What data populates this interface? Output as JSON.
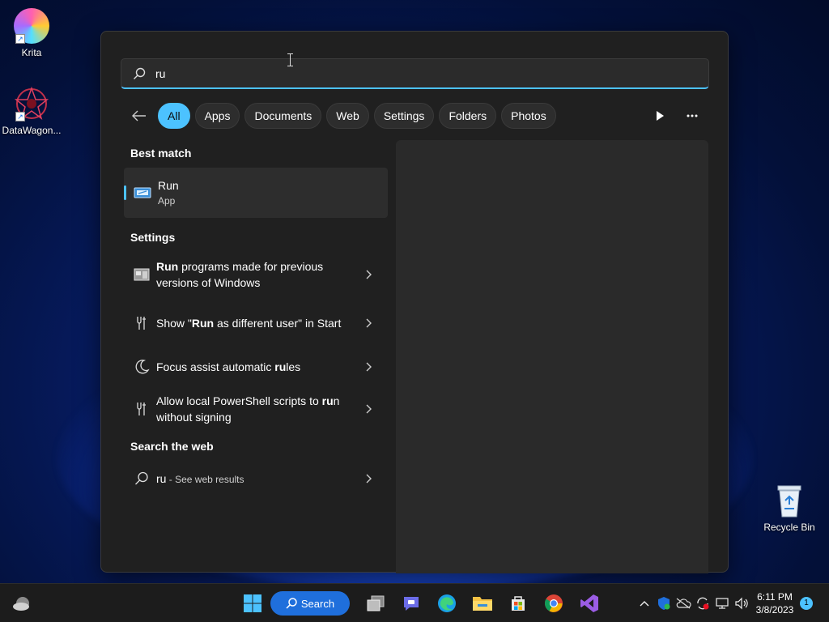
{
  "desktop": {
    "icons": [
      {
        "label": "Krita"
      },
      {
        "label": "DataWagon..."
      },
      {
        "label": "Recycle Bin"
      }
    ]
  },
  "search": {
    "query": "ru",
    "filters": [
      "All",
      "Apps",
      "Documents",
      "Web",
      "Settings",
      "Folders",
      "Photos"
    ],
    "active_filter": "All"
  },
  "results": {
    "best_match_title": "Best match",
    "best_match": {
      "name": "Run",
      "kind": "App"
    },
    "settings_title": "Settings",
    "settings": [
      {
        "pre": "",
        "bold": "Run",
        "post": " programs made for previous versions of Windows",
        "icon": "compatibility-icon"
      },
      {
        "pre": "Show \"",
        "bold": "Run",
        "post": " as different user\" in Start",
        "icon": "settings-tools-icon"
      },
      {
        "pre": "Focus assist automatic ",
        "bold": "ru",
        "post": "les",
        "icon": "moon-icon"
      },
      {
        "pre": "Allow local PowerShell scripts to ",
        "bold": "ru",
        "post": "n without signing",
        "icon": "settings-tools-icon"
      }
    ],
    "web_title": "Search the web",
    "web": {
      "query": "ru",
      "suffix": " - See web results"
    }
  },
  "taskbar": {
    "search_label": "Search",
    "time": "6:11 PM",
    "date": "3/8/2023",
    "notification_count": "1"
  },
  "colors": {
    "accent": "#4cc2ff",
    "panel_bg": "#202020",
    "taskbar_bg": "#1c1c1c",
    "search_pill": "#1f6fdc"
  }
}
